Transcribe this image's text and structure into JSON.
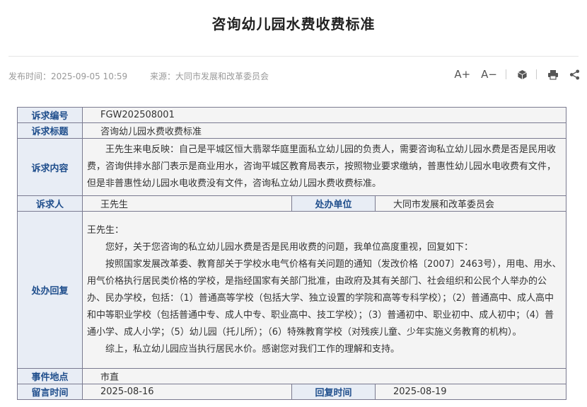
{
  "article": {
    "title": "咨询幼儿园水费收费标准",
    "publish_time": "发布时间：2025-09-05 10:59",
    "source": "来源：大同市发展和改革委员会"
  },
  "toolbar": {
    "font_increase": "A+",
    "font_decrease": "A−"
  },
  "record": {
    "number_label": "诉求编号",
    "number": "FGW202508001",
    "subject_label": "诉求标题",
    "subject": "咨询幼儿园水费收费标准",
    "content_label": "诉求内容",
    "content": "王先生来电反映：自己是平城区恒大翡翠华庭里面私立幼儿园的负责人，需要咨询私立幼儿园水费是否是民用收费，咨询供排水部门表示是商业用水，咨询平城区教育局表示，按照物业要求缴纳，普惠性幼儿园水电收费有文件，但是非普惠性幼儿园水电收费没有文件，咨询私立幼儿园水费收费标准。",
    "petitioner_label": "诉求人",
    "petitioner": "王先生",
    "handler_label": "处办单位",
    "handler": "大同市发展和改革委员会",
    "reply_label": "处办回复",
    "reply_paragraphs": [
      "王先生：",
      "您好，关于您咨询的私立幼儿园水费是否是民用收费的问题，我单位高度重视，回复如下：",
      "按照国家发展改革委、教育部关于学校水电气价格有关问题的通知（发改价格〔2007〕2463号），用电、用水、用气价格执行居民类价格的学校，是指经国家有关部门批准，由政府及其有关部门、社会组织和公民个人举办的公办、民办学校，包括：（1）普通高等学校（包括大学、独立设置的学院和高等专科学校）；（2）普通高中、成人高中和中等职业学校（包括普通中专、成人中专、职业高中、技工学校）；（3）普通初中、职业初中、成人初中；（4）普通小学、成人小学；（5）幼儿园（托儿所）；（6）特殊教育学校（对残疾儿童、少年实施义务教育的机构）。",
      "综上，私立幼儿园应当执行居民水价。感谢您对我们工作的理解和支持。"
    ],
    "location_label": "事件地点",
    "location": "市直",
    "message_time_label": "留言时间",
    "message_time": "2025-08-16",
    "reply_time_label": "回复时间",
    "reply_time": "2025-08-19"
  }
}
